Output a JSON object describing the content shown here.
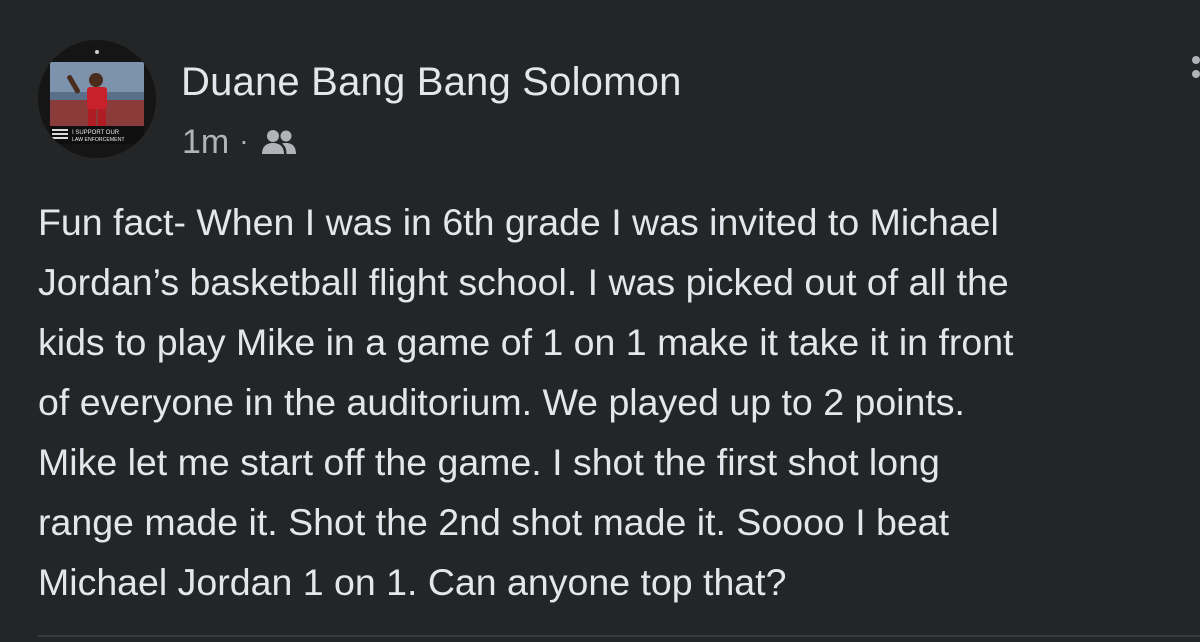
{
  "post": {
    "author": "Duane Bang Bang Solomon",
    "timestamp": "1m",
    "separator": "·",
    "audience_icon": "friends-icon",
    "avatar_caption_line1": "I SUPPORT OUR",
    "avatar_caption_line2": "LAW ENFORCEMENT",
    "body_lines": [
      "Fun fact- When I was in 6th grade I was invited to Michael",
      "Jordan’s basketball flight school. I was picked out of all the",
      "kids to play Mike in a game of 1 on 1 make it take it in front",
      "of everyone in the auditorium. We played up to 2 points.",
      "Mike let me start off the game. I shot the first shot long",
      "range made it. Shot the 2nd shot made it. Soooo I beat",
      "Michael Jordan 1 on 1. Can anyone top that?"
    ]
  },
  "colors": {
    "background": "#242526",
    "primary_text": "#e4e6eb",
    "secondary_text": "#b0b3b8"
  }
}
